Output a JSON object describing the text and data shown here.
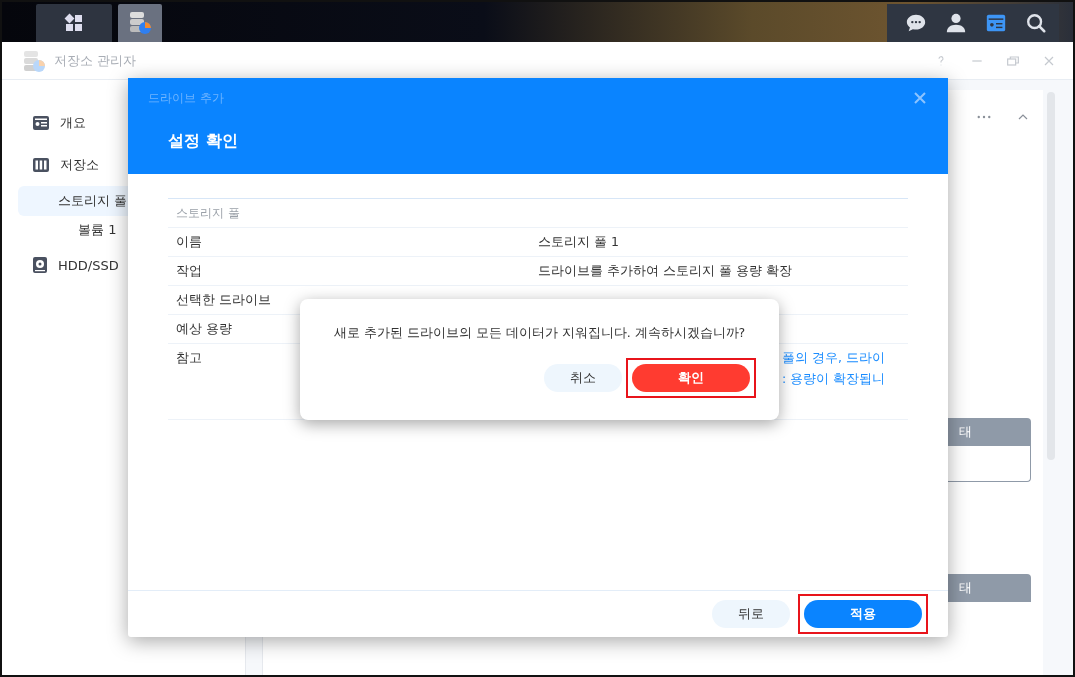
{
  "taskbar": {
    "buttons": [
      {
        "selected": false
      },
      {
        "selected": true
      }
    ]
  },
  "window": {
    "title": "저장소 관리자"
  },
  "sidebar": {
    "items": [
      {
        "label": "개요",
        "selected": false
      },
      {
        "label": "저장소",
        "selected": false,
        "children": [
          {
            "label": "스토리지 풀",
            "selected": true,
            "children": [
              {
                "label": "볼륨 1",
                "selected": false
              }
            ]
          }
        ]
      },
      {
        "label": "HDD/SSD",
        "selected": false
      }
    ]
  },
  "background_panel": {
    "table_headers": [
      "태",
      "태"
    ]
  },
  "wizard": {
    "title": "드라이브 추가",
    "heading": "설정 확인",
    "section": "스토리지 풀",
    "rows": [
      {
        "label": "이름",
        "value": "스토리지 풀 1"
      },
      {
        "label": "작업",
        "value": "드라이브를 추가하여 스토리지 풀 용량 확장"
      },
      {
        "label": "선택한 드라이브"
      },
      {
        "label": "예상 용량"
      },
      {
        "label": "참고",
        "note_lines": [
          "풀의 경우, 드라이",
          ": 용량이 확장됩니"
        ]
      }
    ],
    "buttons": [
      {
        "label": "뒤로",
        "kind": "secondary",
        "highlighted": false
      },
      {
        "label": "적용",
        "kind": "primary",
        "highlighted": true
      }
    ]
  },
  "confirm_dialog": {
    "message": "새로 추가된 드라이브의 모든 데이터가 지워집니다. 계속하시겠습니까?",
    "buttons": [
      {
        "label": "취소",
        "kind": "secondary",
        "highlighted": false
      },
      {
        "label": "확인",
        "kind": "danger",
        "highlighted": true
      }
    ]
  }
}
